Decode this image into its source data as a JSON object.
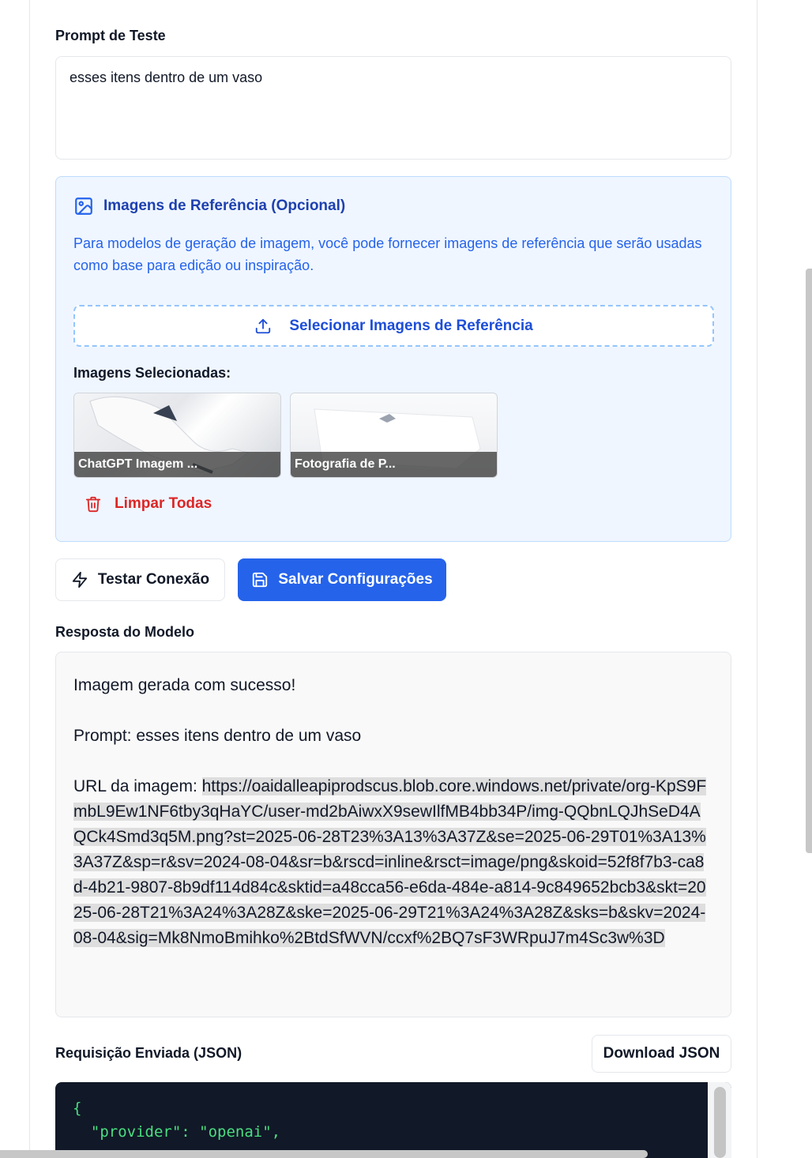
{
  "prompt": {
    "label": "Prompt de Teste",
    "value": "esses itens dentro de um vaso"
  },
  "reference_images": {
    "title": "Imagens de Referência (Opcional)",
    "description": "Para modelos de geração de imagem, você pode fornecer imagens de referência que serão usadas como base para edição ou inspiração.",
    "upload_label": "Selecionar Imagens de Referência",
    "selected_label": "Imagens Selecionadas:",
    "images": [
      {
        "caption": "ChatGPT Imagem ..."
      },
      {
        "caption": "Fotografia de P..."
      }
    ],
    "clear_label": "Limpar Todas"
  },
  "actions": {
    "test_label": "Testar Conexão",
    "save_label": "Salvar Configurações"
  },
  "response": {
    "label": "Resposta do Modelo",
    "line1": "Imagem gerada com sucesso!",
    "line2": "Prompt: esses itens dentro de um vaso",
    "url_prefix": "URL da imagem: ",
    "url": "https://oaidalleapiprodscus.blob.core.windows.net/private/org-KpS9FmbL9Ew1NF6tby3qHaYC/user-md2bAiwxX9sewIlfMB4bb34P/img-QQbnLQJhSeD4AQCk4Smd3q5M.png?st=2025-06-28T23%3A13%3A37Z&se=2025-06-29T01%3A13%3A37Z&sp=r&sv=2024-08-04&sr=b&rscd=inline&rsct=image/png&skoid=52f8f7b3-ca8d-4b21-9807-8b9df114d84c&sktid=a48cca56-e6da-484e-a814-9c849652bcb3&skt=2025-06-28T21%3A24%3A28Z&ske=2025-06-29T21%3A24%3A28Z&sks=b&skv=2024-08-04&sig=Mk8NmoBmihko%2BtdSfWVN/ccxf%2BQ7sF3WRpuJ7m4Sc3w%3D"
  },
  "request": {
    "label": "Requisição Enviada (JSON)",
    "download_label": "Download JSON",
    "code_lines": [
      "{",
      "  \"provider\": \"openai\","
    ]
  },
  "colors": {
    "primary": "#2563eb",
    "danger": "#dc2626",
    "card_bg": "#eff6ff",
    "code_bg": "#111827",
    "code_fg": "#4ade80"
  }
}
